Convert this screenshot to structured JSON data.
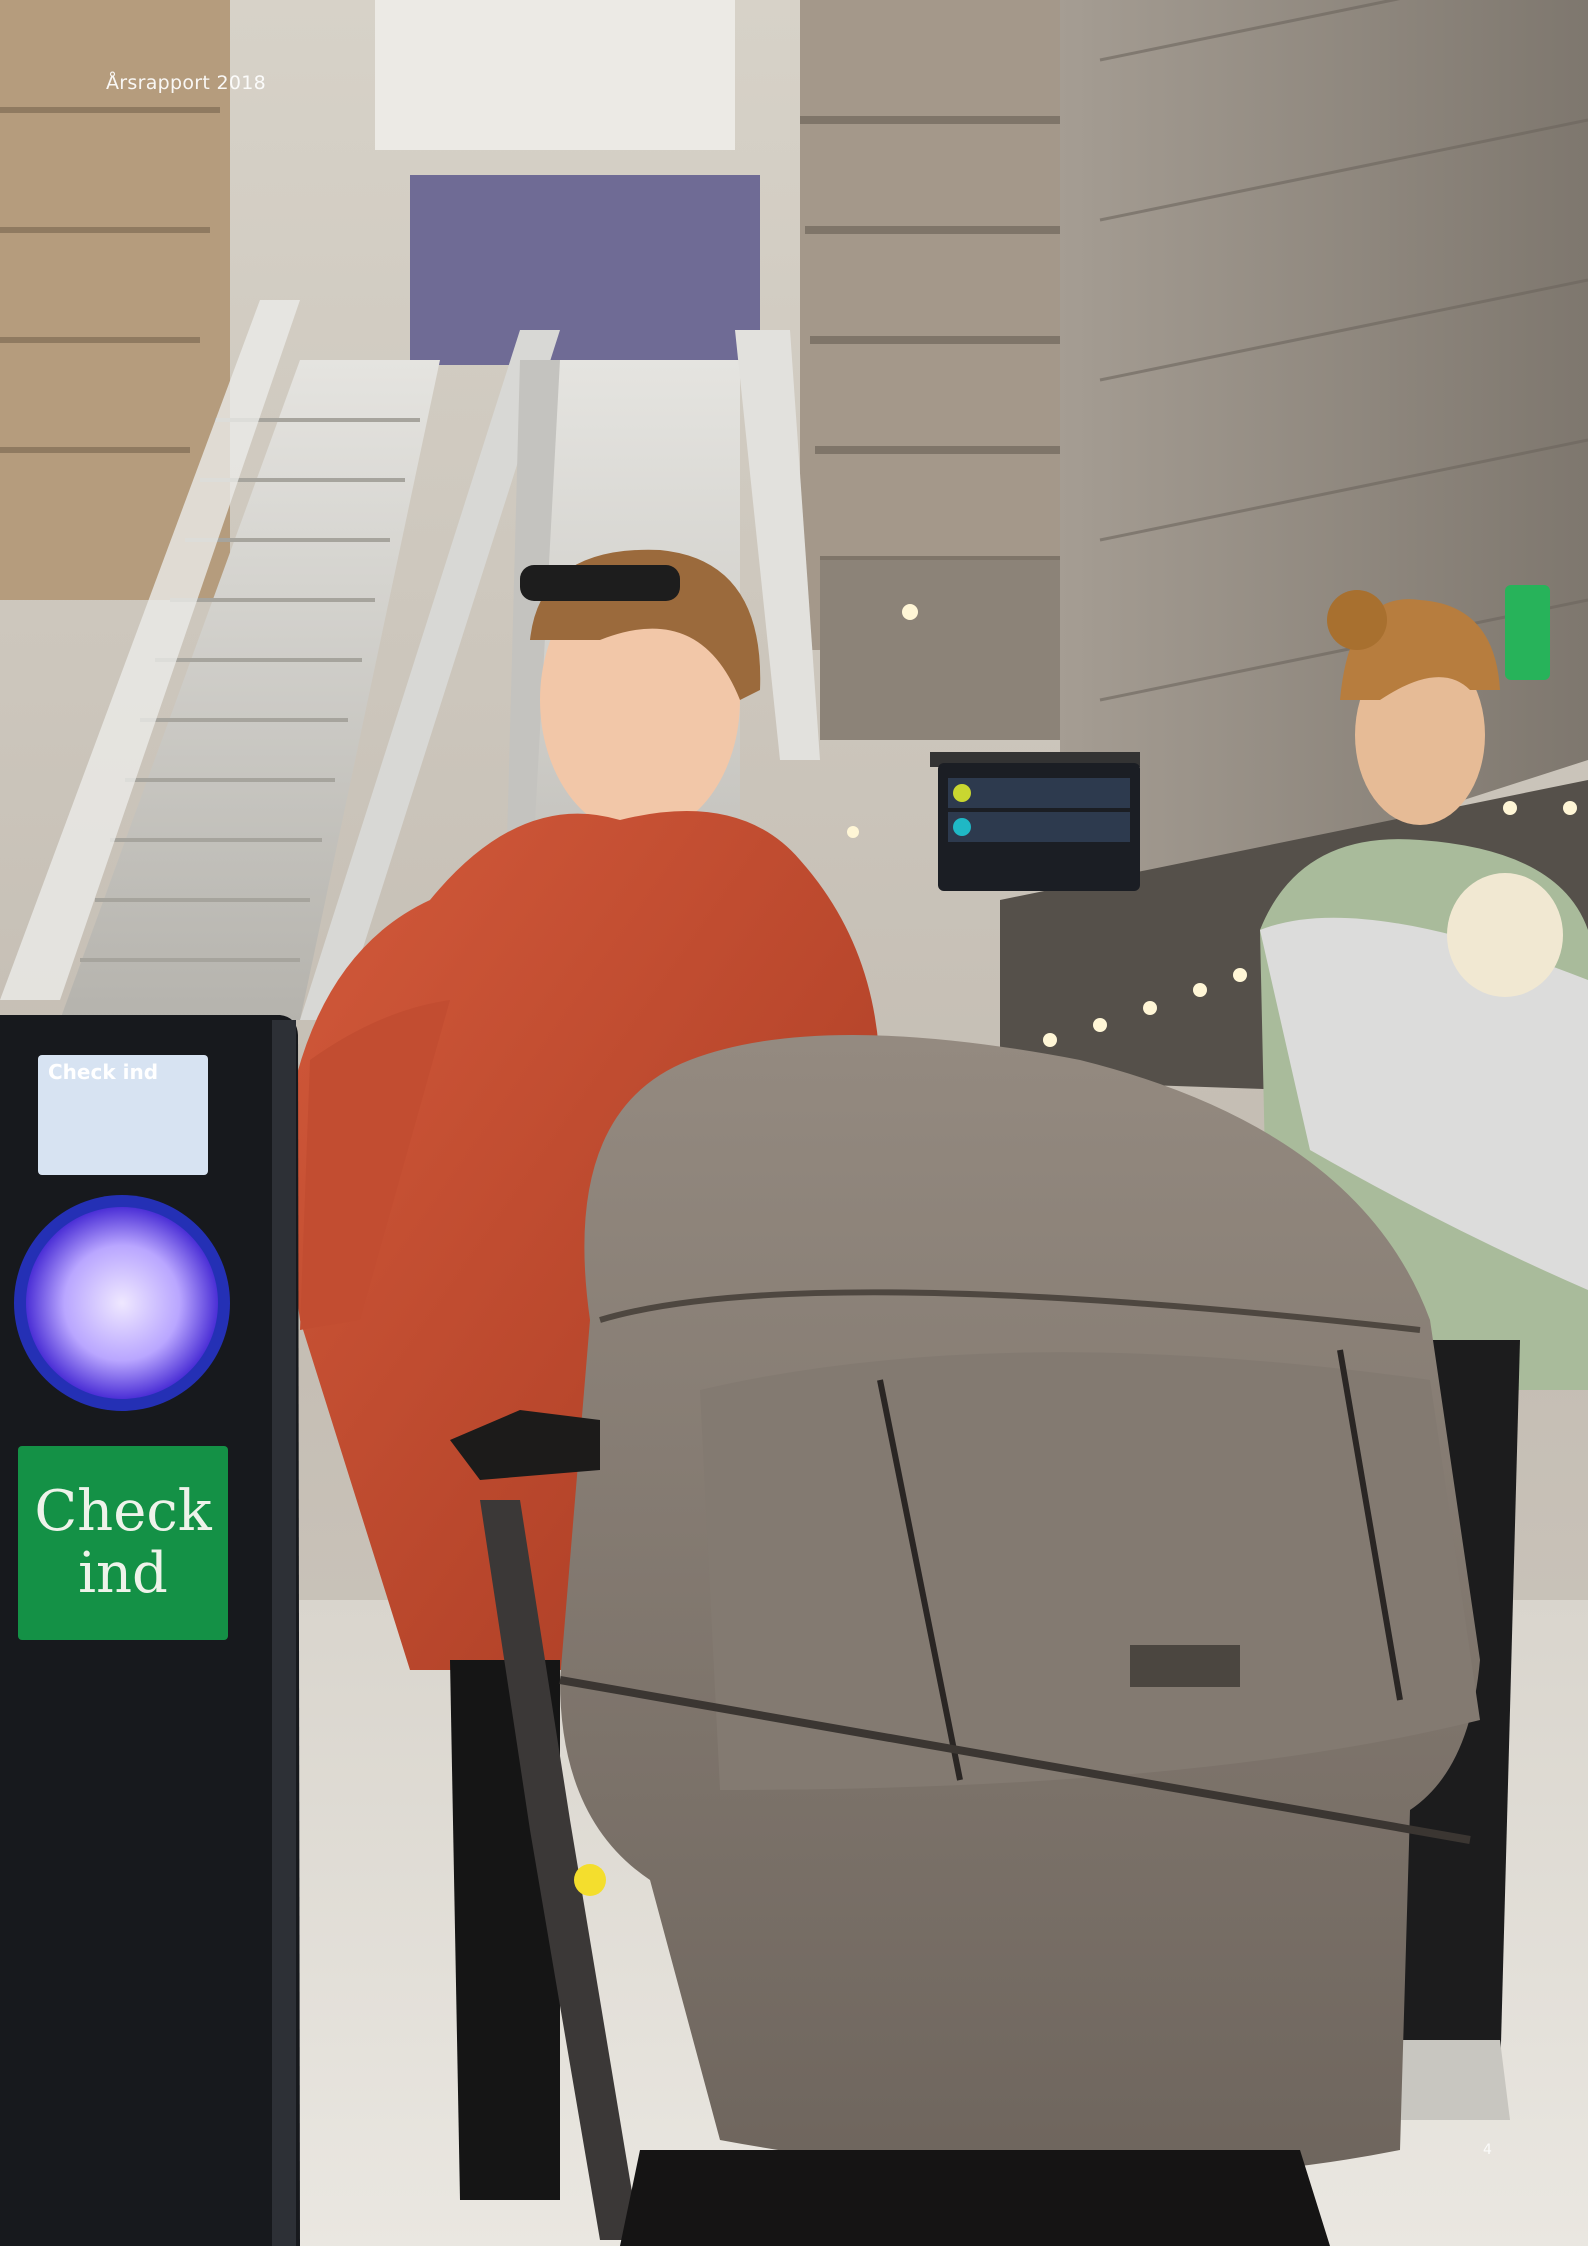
{
  "header": {
    "report_label": "Årsrapport 2018"
  },
  "validator": {
    "screen_title": "Check ind",
    "sign_text": "Check\nind",
    "accent_color": "#149146",
    "light_color": "#b9a6ff"
  },
  "page": {
    "number": "4"
  }
}
